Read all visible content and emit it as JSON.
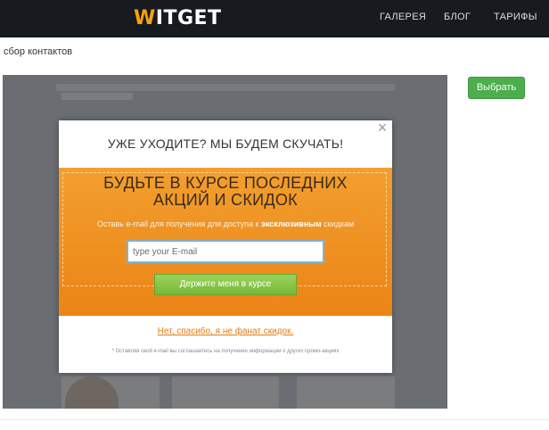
{
  "brand": {
    "logo_text": "WITGET",
    "logo_accent": "#f5a20b"
  },
  "nav": {
    "items": [
      "ГАЛЕРЕЯ",
      "БЛОГ",
      "ТАРИФЫ"
    ]
  },
  "breadcrumb": "сбор контактов",
  "select_button": "Выбрать",
  "popup": {
    "close": "×",
    "headline": "УЖЕ УХОДИТЕ? МЫ БУДЕМ СКУЧАТЬ!",
    "offer_line1": "БУДЬТЕ В КУРСЕ ПОСЛЕДНИХ",
    "offer_line2": "АКЦИЙ И СКИДОК",
    "sub_before": "Оставь e-mail для получения для доступа к ",
    "sub_bold": "эксклюзивным",
    "sub_after": " скидкам",
    "email_placeholder": "type your E-mail",
    "cta": "Держите меня в курсе",
    "decline": "Нет, спасибо, я не фанат скидок.",
    "fine_print": "* Оставляя свой e-mail вы соглашаетесь на получение информации о других промо-акциях"
  },
  "colors": {
    "topbar": "#171a1f",
    "orange": "#eb8416",
    "green": "#4cae4c",
    "cta_green": "#76b735"
  }
}
